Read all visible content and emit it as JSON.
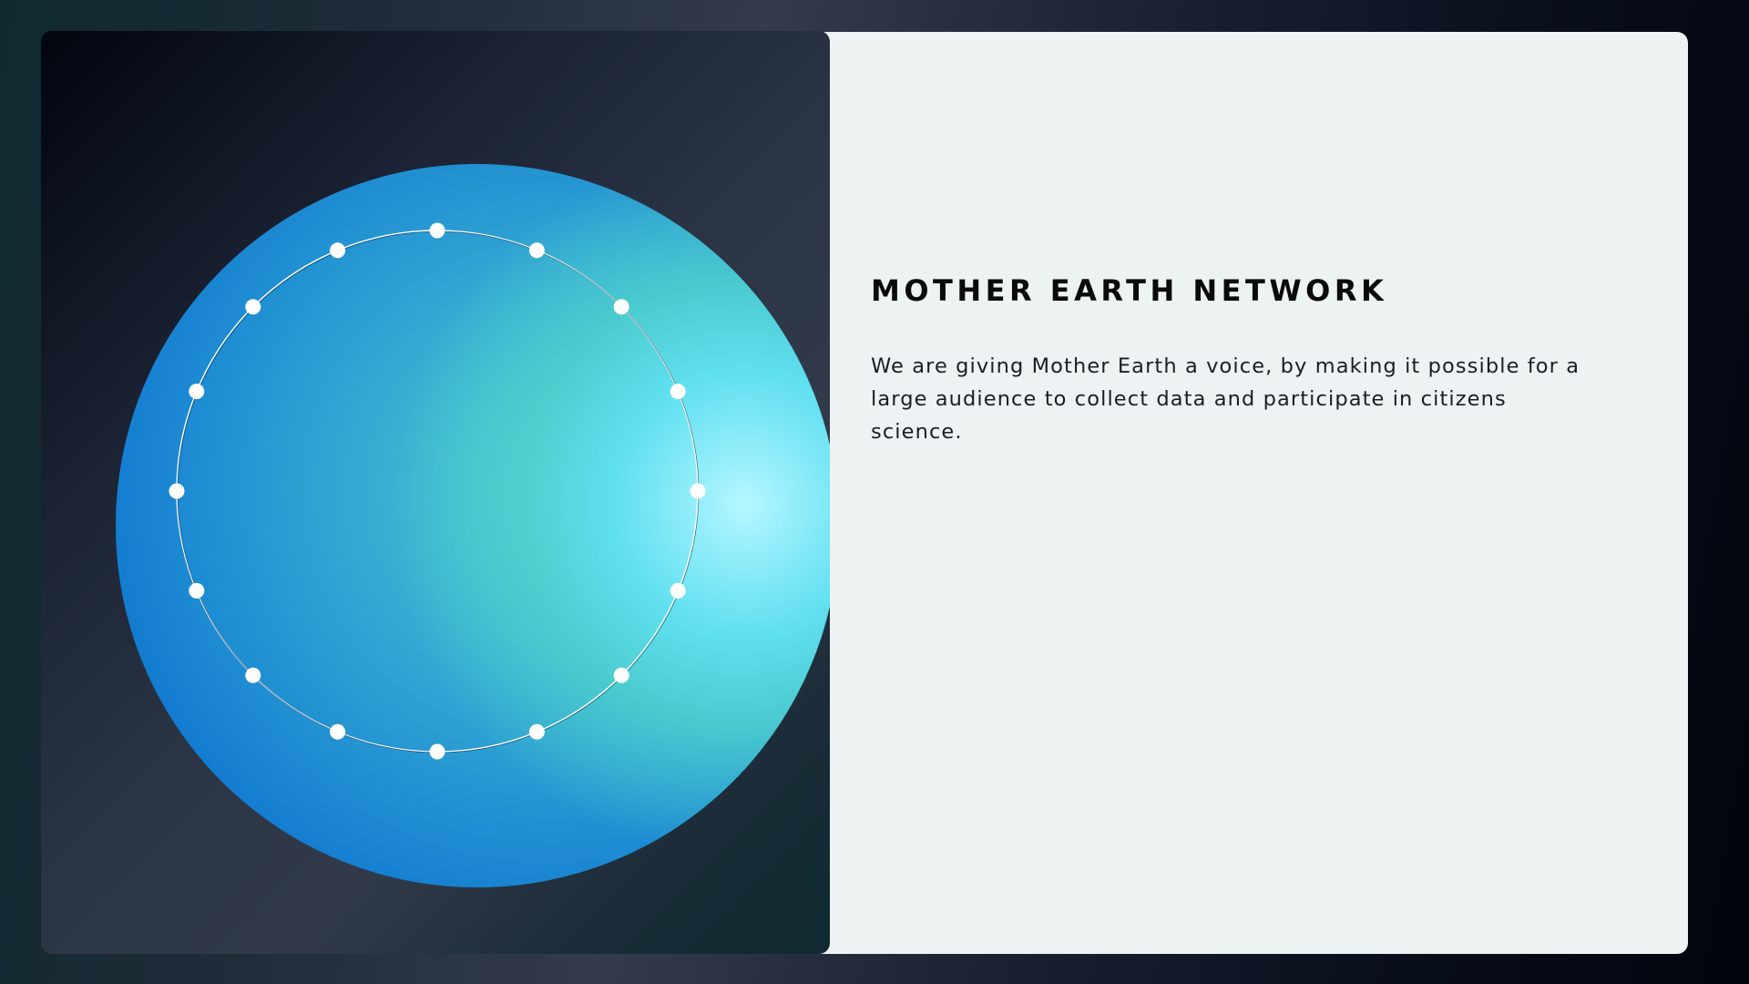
{
  "hero": {
    "title": "MOTHER EARTH NETWORK",
    "description": "We are giving Mother Earth a voice, by making it possible for a large audience to collect data and participate in citizens science."
  },
  "visual": {
    "orb": "earth-orb",
    "ring": "node-ring",
    "node_count": 16,
    "colors": {
      "orb_deep": "#0a6fcf",
      "orb_mid": "#4ec8cf",
      "orb_highlight": "#b5f7ff",
      "node": "#ffffff",
      "panel_light": "#edf3f3",
      "panel_dark": "#1a2233"
    }
  }
}
